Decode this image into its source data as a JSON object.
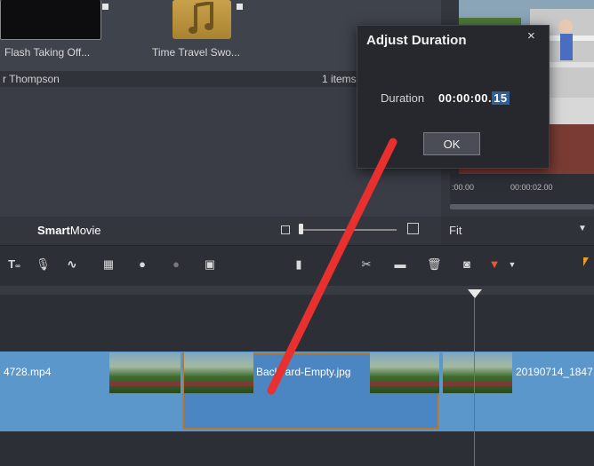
{
  "library": {
    "items": [
      {
        "label": "Flash Taking Off..."
      },
      {
        "label": "Time Travel Swo..."
      }
    ],
    "artist": "r Thompson",
    "count": "1 items"
  },
  "preview": {
    "time_start": ":00.00",
    "time_mid": "00:00:02.00"
  },
  "smartmovie": {
    "bold": "Smart",
    "rest": "Movie"
  },
  "fit": {
    "selected": "Fit"
  },
  "timeline": {
    "clip_left": "4728.mp4",
    "clip_selected": "Backyard-Empty.jpg",
    "clip_right": "20190714_1847"
  },
  "dialog": {
    "title": "Adjust Duration",
    "close": "×",
    "duration_label": "Duration",
    "duration_prefix": "00:00:00.",
    "duration_selected": "15",
    "ok": "OK"
  },
  "toolbar": {
    "text_tool": "T",
    "icons": [
      "text-icon",
      "microphone-icon",
      "audio-wave-icon",
      "grid-icon",
      "globe-icon",
      "disc-icon",
      "image-icon",
      "marker-icon",
      "effects-icon",
      "split-icon",
      "trash-icon",
      "camera-icon",
      "record-marker-icon",
      "pointer-icon"
    ]
  },
  "colors": {
    "accent_selection": "#b57a34",
    "track": "#5c97cc",
    "annotation": "#e8302e",
    "playhead": "#c0504d"
  }
}
